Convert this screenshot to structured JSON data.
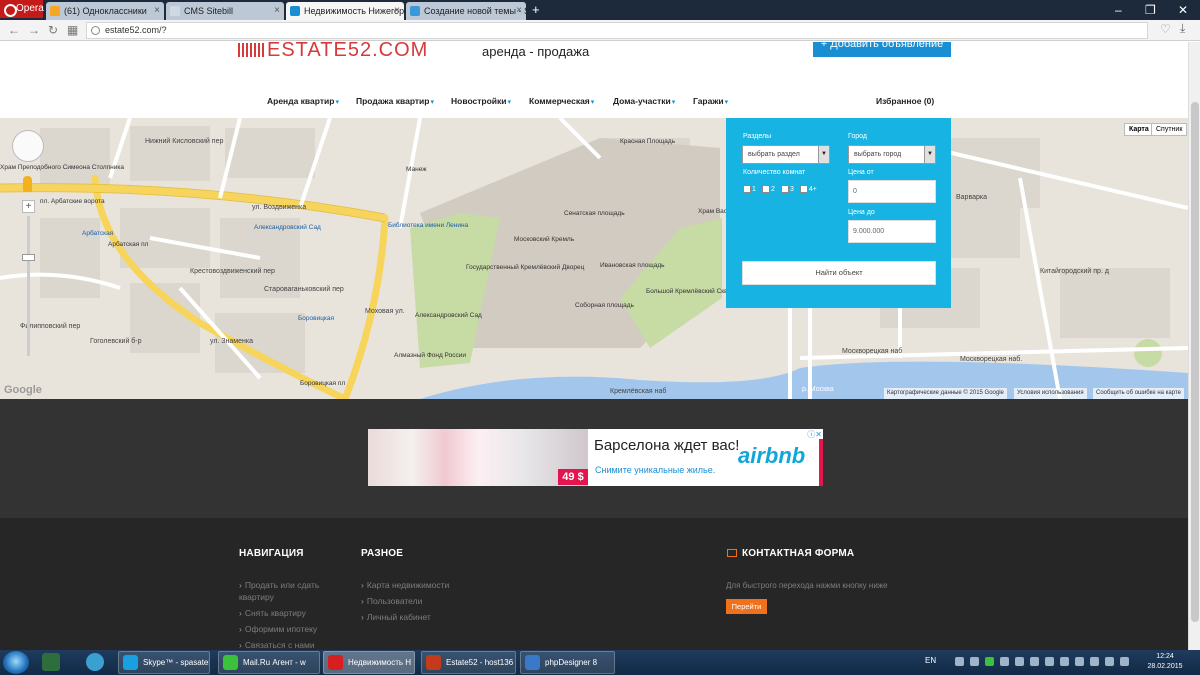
{
  "browser": {
    "menu_label": "Opera",
    "tabs": [
      {
        "label": "(61) Одноклассники",
        "color": "#f5a623"
      },
      {
        "label": "CMS Sitebill",
        "color": "#cfd8e3"
      },
      {
        "label": "Недвижимость Нижегор",
        "color": "#1a8ed2"
      },
      {
        "label": "Создание новой темы - S",
        "color": "#3a9ad9"
      }
    ],
    "new_tab_label": "+",
    "url": "estate52.com/?",
    "window_controls": [
      "–",
      "❐",
      "✕"
    ]
  },
  "site": {
    "logo_text": "ESTATE52.COM",
    "tagline": "аренда - продажа",
    "add_button": "Добавить объявление",
    "nav": [
      {
        "label": "Аренда квартир"
      },
      {
        "label": "Продажа квартир"
      },
      {
        "label": "Новостройки"
      },
      {
        "label": "Коммерческая"
      },
      {
        "label": "Дома-участки"
      },
      {
        "label": "Гаражи"
      }
    ],
    "favorites": "Избранное (0)"
  },
  "map": {
    "type_buttons": [
      "Карта",
      "Спутник"
    ],
    "labels": [
      "Храм Преподобного Симеона Столпника",
      "пл. Арбатские ворота",
      "Арбатская",
      "Арбатская пл",
      "Нижний Кисловский пер",
      "ул. Воздвиженка",
      "Александровский Сад",
      "Библиотека имени Ленина",
      "Манеж",
      "Моховая ул.",
      "Боровицкая",
      "ул. Знаменка",
      "Крестовоздвиженский пер",
      "Староваганьковский пер",
      "Александровский Сад",
      "Государственный Кремлёвский Дворец",
      "Московский Кремль",
      "Сенатская площадь",
      "Красная Площадь",
      "Ивановская площадь",
      "Соборная площадь",
      "Большой Кремлёвский Сквер",
      "Храм Васил Блажен",
      "Алмазный Фонд России",
      "Варварка",
      "Москворецкая наб",
      "Москворецкая наб.",
      "р. Москва",
      "Китайгородский пр. д",
      "Гоголевский б-р",
      "Филипповский пер",
      "Боровицкая пл",
      "Кремлёвская наб"
    ],
    "copyright": "Картографические данные © 2015 Google",
    "terms": "Условия использования",
    "report": "Сообщить об ошибке на карте",
    "google_logo": "Google",
    "colors": {
      "road": "#f7d55d",
      "park": "#c7dba5",
      "water": "#a3c7ec",
      "block": "#dbd6ce"
    }
  },
  "search": {
    "section_label": "Разделы",
    "section_placeholder": "выбрать раздел",
    "city_label": "Город",
    "city_placeholder": "выбрать город",
    "rooms_label": "Количество комнат",
    "rooms": [
      "1",
      "2",
      "3",
      "4+"
    ],
    "price_from_label": "Цена от",
    "price_from_value": "0",
    "price_to_label": "Цена до",
    "price_to_value": "9.000.000",
    "find_button": "Найти объект",
    "bg_color": "#17b4e3"
  },
  "ad": {
    "headline": "Барселона ждет вас!",
    "subline": "Снимите уникальные жилье.",
    "brand": "airbnb",
    "price": "49 $"
  },
  "footer": {
    "nav_title": "НАВИГАЦИЯ",
    "nav_items": [
      "Продать или сдать",
      "квартиру",
      "Снять квартиру",
      "Оформим ипотеку",
      "Связаться с нами"
    ],
    "misc_title": "РАЗНОЕ",
    "misc_items": [
      "Карта недвижимости",
      "Пользователи",
      "Личный кабинет"
    ],
    "contact_title": "КОНТАКТНАЯ ФОРМА",
    "contact_hint": "Для быстрого перехода нажми кнопку ниже",
    "contact_button": "Перейти",
    "accent": "#f0711b"
  },
  "taskbar": {
    "tasks": [
      {
        "label": "Skype™ - spasatel",
        "color": "#1aa0e0"
      },
      {
        "label": "Mail.Ru Агент - w",
        "color": "#3cc13c"
      },
      {
        "label": "Недвижимость Н",
        "color": "#d81f1f"
      },
      {
        "label": "Estate52 - host136",
        "color": "#c53a1a"
      },
      {
        "label": "phpDesigner 8",
        "color": "#3a78c9"
      }
    ],
    "lang": "EN",
    "time": "12:24",
    "date": "28.02.2015"
  }
}
